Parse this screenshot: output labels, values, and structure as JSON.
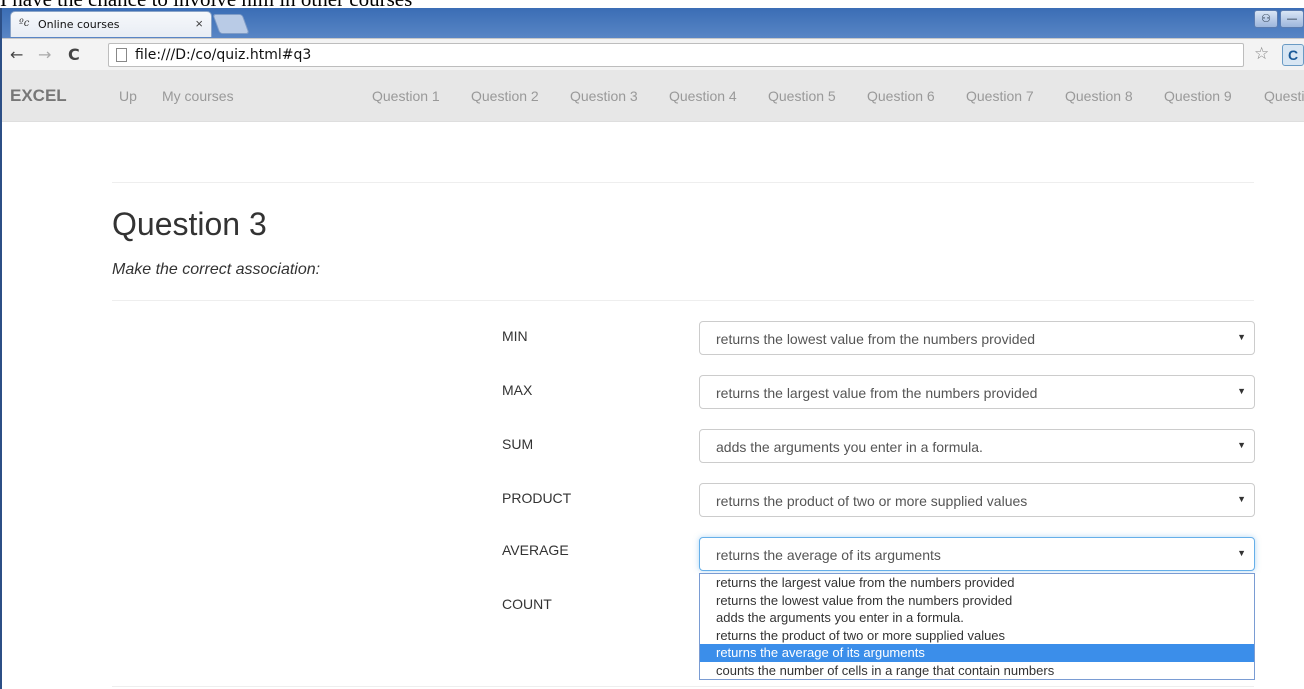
{
  "doc_fragment": "I have the chance to involve him in other courses",
  "browser": {
    "tab_favicon": "ᵒc",
    "tab_title": "Online courses",
    "tab_close": "×",
    "url": "file:///D:/co/quiz.html#q3",
    "back": "←",
    "forward": "→",
    "reload": "C",
    "bookmark_star": "☆",
    "extension": "C",
    "window_buttons": [
      "👤",
      "—",
      "▢"
    ]
  },
  "navbar": {
    "brand": "EXCEL",
    "links": [
      "Up",
      "My courses"
    ],
    "questions": [
      "Question 1",
      "Question 2",
      "Question 3",
      "Question 4",
      "Question 5",
      "Question 6",
      "Question 7",
      "Question 8",
      "Question 9",
      "Questi"
    ]
  },
  "question": {
    "title": "Question 3",
    "instruction": "Make the correct association:"
  },
  "rows": [
    {
      "label": "MIN",
      "value": "returns the lowest value from the numbers provided"
    },
    {
      "label": "MAX",
      "value": "returns the largest value from the numbers provided"
    },
    {
      "label": "SUM",
      "value": "adds the arguments you enter in a formula."
    },
    {
      "label": "PRODUCT",
      "value": "returns the product of two or more supplied values"
    },
    {
      "label": "AVERAGE",
      "value": "returns the average of its arguments"
    },
    {
      "label": "COUNT",
      "value": ""
    }
  ],
  "caret": "▼",
  "dropdown_options": [
    "returns the largest value from the numbers provided",
    "returns the lowest value from the numbers provided",
    "adds the arguments you enter in a formula.",
    "returns the product of two or more supplied values",
    "returns the average of its arguments",
    "counts the number of cells in a range that contain numbers"
  ],
  "dropdown_selected_option": "returns the average of its arguments",
  "colors": {
    "accent": "#3b8eea",
    "navbar_bg": "#e7e7e7",
    "focus_ring": "#66afe9"
  }
}
